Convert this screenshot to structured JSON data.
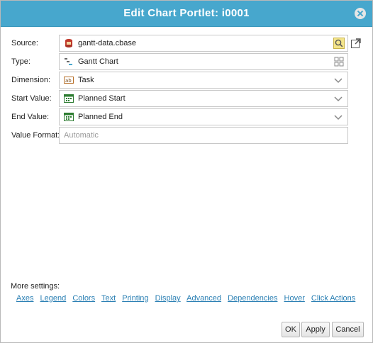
{
  "dialog": {
    "title": "Edit Chart Portlet: i0001"
  },
  "form": {
    "source": {
      "label": "Source:",
      "value": "gantt-data.cbase"
    },
    "type": {
      "label": "Type:",
      "value": "Gantt Chart"
    },
    "dimension": {
      "label": "Dimension:",
      "value": "Task"
    },
    "start_value": {
      "label": "Start Value:",
      "value": "Planned Start"
    },
    "end_value": {
      "label": "End Value:",
      "value": "Planned End"
    },
    "value_format": {
      "label": "Value Format:",
      "placeholder": "Automatic"
    }
  },
  "more_settings": {
    "label": "More settings:",
    "links": [
      "Axes",
      "Legend",
      "Colors",
      "Text",
      "Printing",
      "Display",
      "Advanced",
      "Dependencies",
      "Hover",
      "Click Actions"
    ]
  },
  "buttons": {
    "ok": "OK",
    "apply": "Apply",
    "cancel": "Cancel"
  },
  "colors": {
    "titlebar": "#47a7cd",
    "link": "#2a7fb3"
  }
}
